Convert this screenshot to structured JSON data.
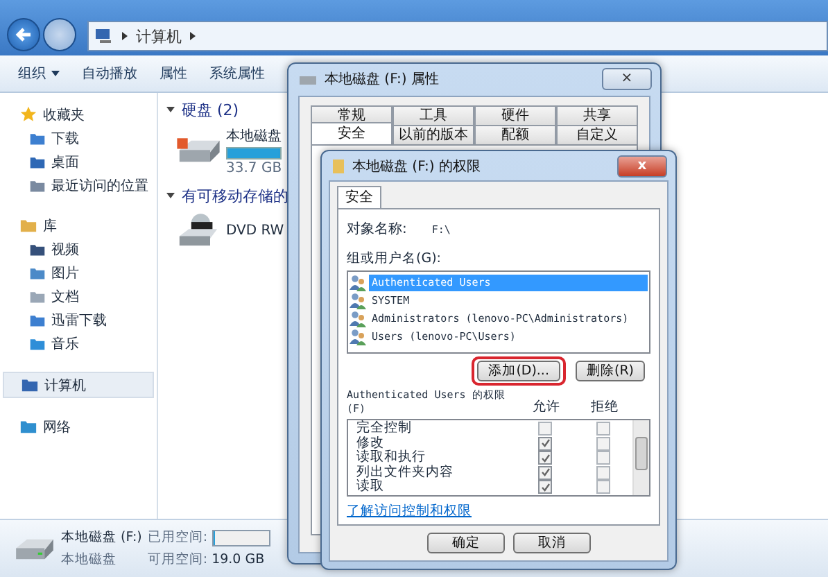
{
  "explorer": {
    "address": [
      "计算机"
    ],
    "toolbar": [
      {
        "label": "组织",
        "dropdown": true
      },
      {
        "label": "自动播放",
        "dropdown": false
      },
      {
        "label": "属性",
        "dropdown": false
      },
      {
        "label": "系统属性",
        "dropdown": false
      }
    ],
    "sidebar": [
      {
        "label": "收藏夹",
        "selected": false,
        "children": [
          {
            "label": "下载",
            "selected": false
          },
          {
            "label": "桌面",
            "selected": false
          },
          {
            "label": "最近访问的位置",
            "selected": false
          }
        ]
      },
      {
        "label": "库",
        "selected": false,
        "children": [
          {
            "label": "视频",
            "selected": false
          },
          {
            "label": "图片",
            "selected": false
          },
          {
            "label": "文档",
            "selected": false
          },
          {
            "label": "迅雷下载",
            "selected": false
          },
          {
            "label": "音乐",
            "selected": false
          }
        ]
      },
      {
        "label": "计算机",
        "selected": true
      },
      {
        "label": "网络",
        "selected": false
      }
    ],
    "sections": [
      {
        "heading": "硬盘 (2)",
        "items": [
          {
            "kind": "disk",
            "name": "本地磁盘",
            "level": 1,
            "info": "33.7 GB"
          }
        ]
      },
      {
        "heading": "有可移动存储的",
        "items": [
          {
            "kind": "dvd",
            "name": "DVD RW"
          }
        ]
      }
    ],
    "details": {
      "name": "本地磁盘 (F:)",
      "type": "本地磁盘",
      "used_label": "已用空间:",
      "level": 0.02,
      "free_label": "可用空间:",
      "free": "19.0 GB"
    }
  },
  "properties_dialog": {
    "title": "本地磁盘 (F:) 属性",
    "close": "⨯",
    "tab_rows": [
      [
        {
          "label": "常规",
          "selected": false
        },
        {
          "label": "工具",
          "selected": false
        },
        {
          "label": "硬件",
          "selected": false
        },
        {
          "label": "共享",
          "selected": false
        }
      ],
      [
        {
          "label": "安全",
          "selected": true
        },
        {
          "label": "以前的版本",
          "selected": false
        },
        {
          "label": "配额",
          "selected": false
        },
        {
          "label": "自定义",
          "selected": false
        }
      ]
    ]
  },
  "permissions_dialog": {
    "title": "本地磁盘 (F:) 的权限",
    "close": "x",
    "tabs": [
      {
        "label": "安全",
        "selected": true
      }
    ],
    "object_label": "对象名称:",
    "object_value": "F:\\",
    "group_label": "组或用户名(G):",
    "users": [
      {
        "name": "Authenticated Users",
        "selected": true
      },
      {
        "name": "SYSTEM",
        "selected": false
      },
      {
        "name": "Administrators (lenovo-PC\\Administrators)",
        "selected": false
      },
      {
        "name": "Users (lenovo-PC\\Users)",
        "selected": false
      }
    ],
    "user_buttons": [
      {
        "label": "添加(D)...",
        "highlighted": true
      },
      {
        "label": "删除(R)",
        "highlighted": false
      }
    ],
    "perm_label": "Authenticated Users 的权限",
    "perm_label_line2": "(F)",
    "allow_header": "允许",
    "deny_header": "拒绝",
    "permissions": [
      {
        "name": "完全控制",
        "allow": false,
        "deny": false
      },
      {
        "name": "修改",
        "allow": true,
        "deny": false
      },
      {
        "name": "读取和执行",
        "allow": true,
        "deny": false
      },
      {
        "name": "列出文件夹内容",
        "allow": true,
        "deny": false
      },
      {
        "name": "读取",
        "allow": true,
        "deny": false
      }
    ],
    "link": "了解访问控制和权限",
    "buttons": [
      "确定",
      "取消"
    ]
  }
}
